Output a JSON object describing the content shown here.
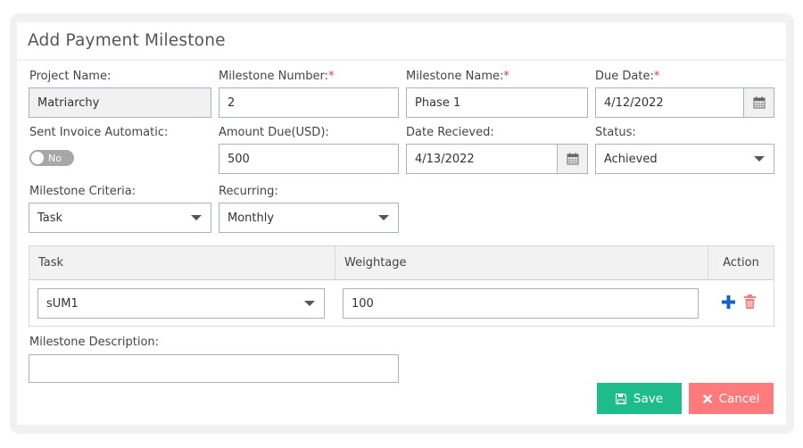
{
  "card": {
    "title": "Add Payment Milestone"
  },
  "fields": {
    "project_name": {
      "label": "Project Name:",
      "value": "Matriarchy",
      "required": false
    },
    "milestone_number": {
      "label": "Milestone Number:",
      "value": "2",
      "required_mark": "*"
    },
    "milestone_name": {
      "label": "Milestone Name:",
      "value": "Phase 1",
      "required_mark": "*"
    },
    "due_date": {
      "label": "Due Date:",
      "value": "4/12/2022",
      "required_mark": "*",
      "icon": "calendar-icon"
    },
    "sent_invoice": {
      "label": "Sent Invoice Automatic:",
      "toggle_text": "No",
      "checked": false
    },
    "amount_due": {
      "label": "Amount Due(USD):",
      "value": "500"
    },
    "date_received": {
      "label": "Date Recieved:",
      "value": "4/13/2022",
      "icon": "calendar-icon"
    },
    "status": {
      "label": "Status:",
      "value": "Achieved"
    },
    "milestone_criteria": {
      "label": "Milestone Criteria:",
      "value": "Task"
    },
    "recurring": {
      "label": "Recurring:",
      "value": "Monthly"
    },
    "description": {
      "label": "Milestone Description:",
      "value": ""
    }
  },
  "task_table": {
    "columns": [
      "Task",
      "Weightage",
      "Action"
    ],
    "rows": [
      {
        "task": "sUM1",
        "weightage": "100",
        "actions": [
          "plus-icon",
          "trash-icon"
        ]
      }
    ]
  },
  "buttons": {
    "save": {
      "label": "Save",
      "icon": "save-icon"
    },
    "cancel": {
      "label": "Cancel",
      "icon": "close-icon"
    }
  },
  "colors": {
    "save": "#1ebc8b",
    "cancel": "#ff7b7b",
    "add_icon": "#1565c0",
    "delete_icon": "#ff7b7b",
    "required": "#e53935"
  }
}
